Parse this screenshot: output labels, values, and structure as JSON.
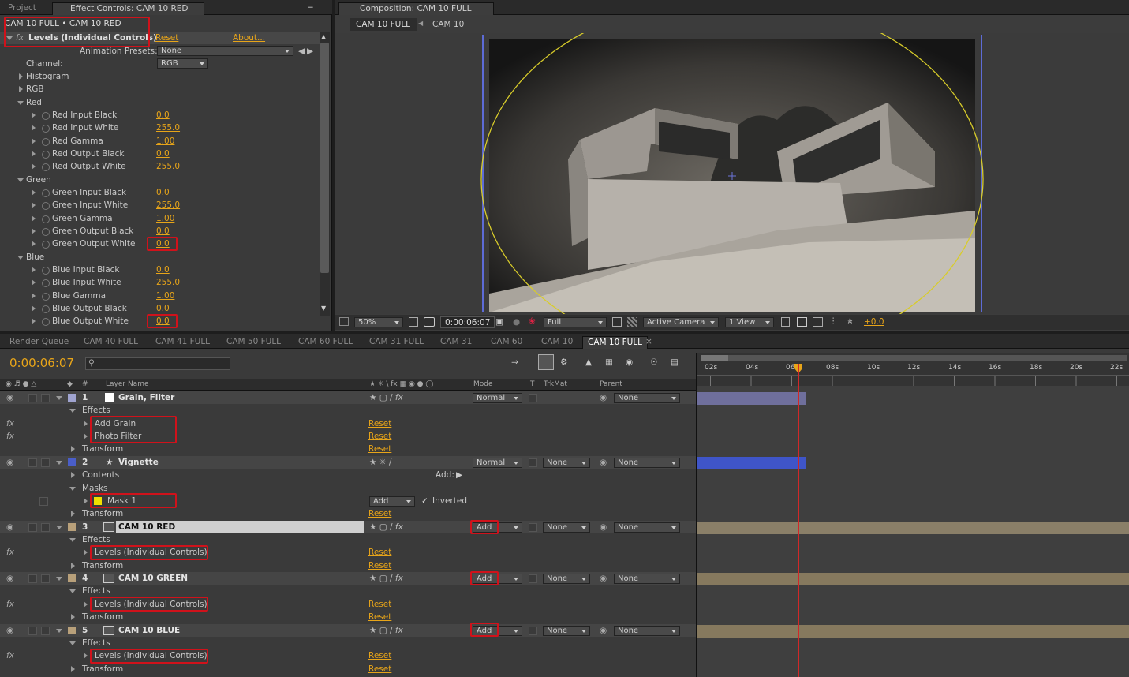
{
  "effect_panel": {
    "tab_project": "Project",
    "tab_effect_controls": "Effect Controls: CAM 10 RED",
    "breadcrumb": "CAM 10 FULL • CAM 10 RED",
    "effect_name": "Levels (Individual Controls)",
    "reset": "Reset",
    "about": "About...",
    "presets_label": "Animation Presets:",
    "presets_value": "None",
    "channel_label": "Channel:",
    "channel_value": "RGB",
    "histogram": "Histogram",
    "rgb": "RGB",
    "groups": [
      {
        "name": "Red",
        "props": [
          {
            "label": "Red Input Black",
            "value": "0.0"
          },
          {
            "label": "Red Input White",
            "value": "255.0"
          },
          {
            "label": "Red Gamma",
            "value": "1.00"
          },
          {
            "label": "Red Output Black",
            "value": "0.0"
          },
          {
            "label": "Red Output White",
            "value": "255.0"
          }
        ]
      },
      {
        "name": "Green",
        "props": [
          {
            "label": "Green Input Black",
            "value": "0.0"
          },
          {
            "label": "Green Input White",
            "value": "255.0"
          },
          {
            "label": "Green Gamma",
            "value": "1.00"
          },
          {
            "label": "Green Output Black",
            "value": "0.0"
          },
          {
            "label": "Green Output White",
            "value": "0.0"
          }
        ]
      },
      {
        "name": "Blue",
        "props": [
          {
            "label": "Blue Input Black",
            "value": "0.0"
          },
          {
            "label": "Blue Input White",
            "value": "255.0"
          },
          {
            "label": "Blue Gamma",
            "value": "1.00"
          },
          {
            "label": "Blue Output Black",
            "value": "0.0"
          },
          {
            "label": "Blue Output White",
            "value": "0.0"
          }
        ]
      }
    ]
  },
  "comp_panel": {
    "tab": "Composition: CAM 10 FULL",
    "crumb_1": "CAM 10 FULL",
    "crumb_2": "CAM 10",
    "zoom": "50%",
    "timecode": "0:00:06:07",
    "resolution": "Full",
    "camera": "Active Camera",
    "view": "1 View",
    "exposure": "+0.0"
  },
  "timeline": {
    "tabs": [
      "Render Queue",
      "CAM 40 FULL",
      "CAM 41 FULL",
      "CAM 50 FULL",
      "CAM 60 FULL",
      "CAM 31 FULL",
      "CAM 31",
      "CAM 60",
      "CAM 10",
      "CAM 10 FULL"
    ],
    "timecode": "0:00:06:07",
    "col_hash": "#",
    "col_layer_name": "Layer Name",
    "col_mode": "Mode",
    "col_t": "T",
    "col_trkmat": "TrkMat",
    "col_parent": "Parent",
    "ruler": [
      "02s",
      "04s",
      "06s",
      "08s",
      "10s",
      "12s",
      "14s",
      "16s",
      "18s",
      "20s",
      "22s"
    ],
    "layers": {
      "l1_num": "1",
      "l1_name": "Grain, Filter",
      "l1_mode": "Normal",
      "l1_parent": "None",
      "effects": "Effects",
      "transform": "Transform",
      "reset": "Reset",
      "add_grain": "Add Grain",
      "photo_filter": "Photo Filter",
      "l2_num": "2",
      "l2_name": "Vignette",
      "l2_mode": "Normal",
      "l2_trkmat": "None",
      "l2_parent": "None",
      "contents": "Contents",
      "add": "Add:",
      "masks": "Masks",
      "mask1": "Mask 1",
      "mask_mode": "Add",
      "inverted": "Inverted",
      "l3_num": "3",
      "l3_name": "CAM 10 RED",
      "l3_mode": "Add",
      "l3_trkmat": "None",
      "l3_parent": "None",
      "levels": "Levels (Individual Controls)",
      "l4_num": "4",
      "l4_name": "CAM 10 GREEN",
      "l4_mode": "Add",
      "l4_trkmat": "None",
      "l4_parent": "None",
      "l5_num": "5",
      "l5_name": "CAM 10 BLUE",
      "l5_mode": "Add",
      "l5_trkmat": "None",
      "l5_parent": "None"
    }
  }
}
